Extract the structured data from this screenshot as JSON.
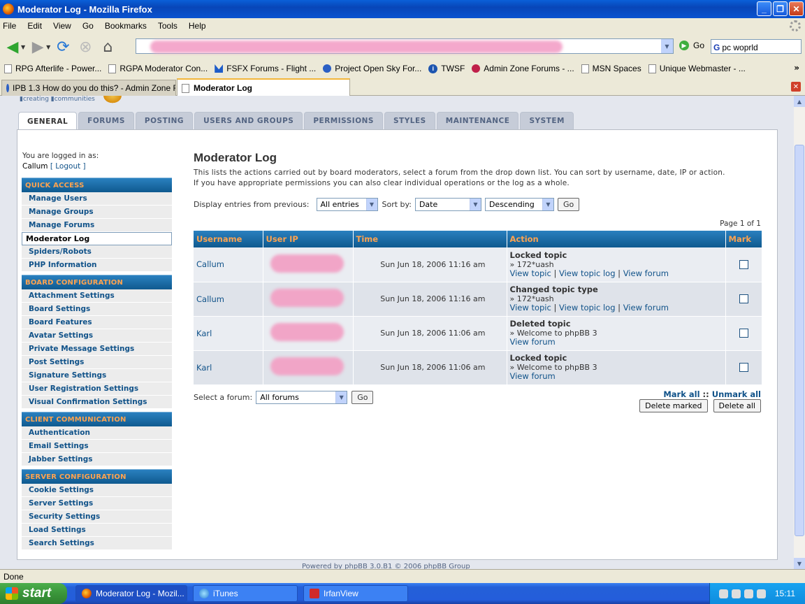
{
  "window": {
    "title": "Moderator Log - Mozilla Firefox",
    "min": "_",
    "max": "❐",
    "close": "✕"
  },
  "menu": [
    "File",
    "Edit",
    "View",
    "Go",
    "Bookmarks",
    "Tools",
    "Help"
  ],
  "nav": {
    "go_label": "Go",
    "search_value": "pc woprld"
  },
  "bookmarks": [
    "RPG Afterlife - Power...",
    "RGPA Moderator Con...",
    "FSFX Forums - Flight ...",
    "Project Open Sky For...",
    "TWSF",
    "Admin Zone Forums - ...",
    "MSN Spaces",
    "Unique Webmaster - ..."
  ],
  "tabs": [
    {
      "label": "IPB 1.3 How do you do this? - Admin Zone F..."
    },
    {
      "label": "Moderator Log"
    }
  ],
  "site": {
    "logo_text": "▮creating ▮communities"
  },
  "acp_tabs": [
    "GENERAL",
    "FORUMS",
    "POSTING",
    "USERS AND GROUPS",
    "PERMISSIONS",
    "STYLES",
    "MAINTENANCE",
    "SYSTEM"
  ],
  "user": {
    "logged_label": "You are logged in as:",
    "name": "Callum",
    "logout": "[ Logout ]"
  },
  "sidebar": {
    "quick_access": {
      "title": "QUICK ACCESS",
      "items": [
        "Manage Users",
        "Manage Groups",
        "Manage Forums",
        "Moderator Log",
        "Spiders/Robots",
        "PHP Information"
      ]
    },
    "board_configuration": {
      "title": "BOARD CONFIGURATION",
      "items": [
        "Attachment Settings",
        "Board Settings",
        "Board Features",
        "Avatar Settings",
        "Private Message Settings",
        "Post Settings",
        "Signature Settings",
        "User Registration Settings",
        "Visual Confirmation Settings"
      ]
    },
    "client_communication": {
      "title": "CLIENT COMMUNICATION",
      "items": [
        "Authentication",
        "Email Settings",
        "Jabber Settings"
      ]
    },
    "server_configuration": {
      "title": "SERVER CONFIGURATION",
      "items": [
        "Cookie Settings",
        "Server Settings",
        "Security Settings",
        "Load Settings",
        "Search Settings"
      ]
    }
  },
  "main": {
    "title": "Moderator Log",
    "description_1": "This lists the actions carried out by board moderators, select a forum from the drop down list. You can sort by username, date, IP or action.",
    "description_2": "If you have appropriate permissions you can also clear individual operations or the log as a whole.",
    "display_label": "Display entries from previous:",
    "display_value": "All entries",
    "sort_label": "Sort by:",
    "sort_value": "Date",
    "order_value": "Descending",
    "go": "Go",
    "page_info": "Page 1 of 1",
    "columns": [
      "Username",
      "User IP",
      "Time",
      "Action",
      "Mark"
    ],
    "rows": [
      {
        "user": "Callum",
        "time": "Sun Jun 18, 2006 11:16 am",
        "action": "Locked topic",
        "detail": "» 172*uash",
        "links": [
          "View topic",
          "View topic log",
          "View forum"
        ]
      },
      {
        "user": "Callum",
        "time": "Sun Jun 18, 2006 11:16 am",
        "action": "Changed topic type",
        "detail": "» 172*uash",
        "links": [
          "View topic",
          "View topic log",
          "View forum"
        ]
      },
      {
        "user": "Karl",
        "time": "Sun Jun 18, 2006 11:06 am",
        "action": "Deleted topic",
        "detail": "» Welcome to phpBB 3",
        "links": [
          "View forum"
        ]
      },
      {
        "user": "Karl",
        "time": "Sun Jun 18, 2006 11:06 am",
        "action": "Locked topic",
        "detail": "» Welcome to phpBB 3",
        "links": [
          "View forum"
        ]
      }
    ],
    "select_forum_label": "Select a forum:",
    "select_forum_value": "All forums",
    "mark_all": "Mark all",
    "unmark_all": "Unmark all",
    "mark_sep": "::",
    "delete_marked": "Delete marked",
    "delete_all": "Delete all"
  },
  "powered": "Powered by phpBB 3.0.B1 © 2006 phpBB Group",
  "status": "Done",
  "taskbar": {
    "start": "start",
    "tasks": [
      "Moderator Log - Mozil...",
      "iTunes",
      "IrfanView"
    ],
    "clock": "15:11"
  }
}
